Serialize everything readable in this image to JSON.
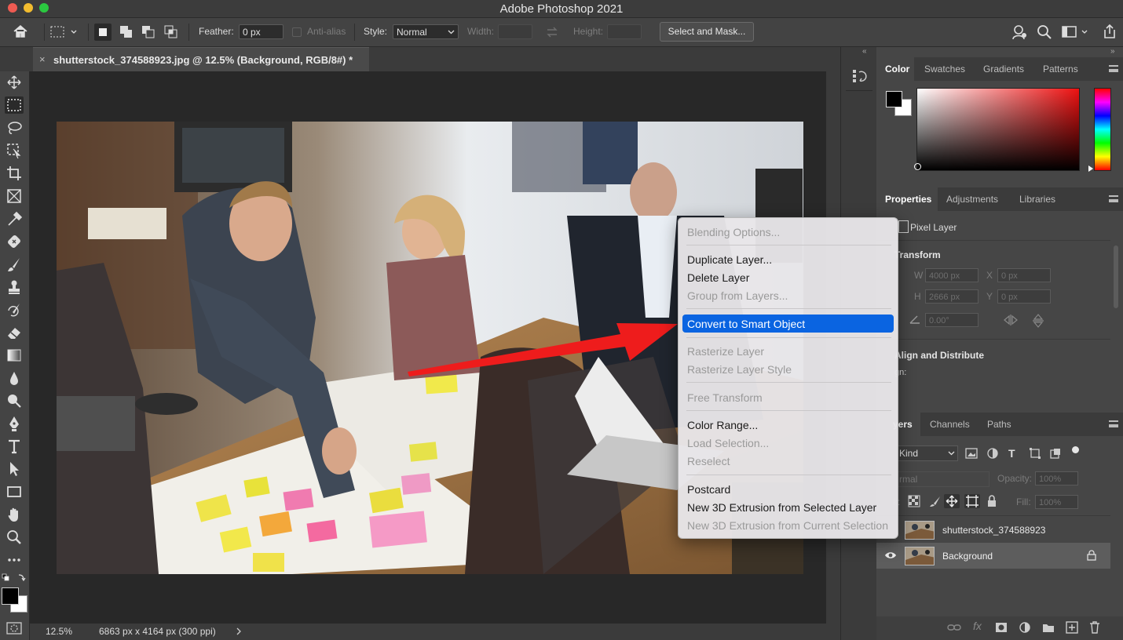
{
  "app": {
    "title": "Adobe Photoshop 2021"
  },
  "options_bar": {
    "feather_label": "Feather:",
    "feather_value": "0 px",
    "antialias_label": "Anti-alias",
    "style_label": "Style:",
    "style_value": "Normal",
    "width_label": "Width:",
    "height_label": "Height:",
    "select_mask_label": "Select and Mask..."
  },
  "document": {
    "tab_label": "shutterstock_374588923.jpg @ 12.5% (Background, RGB/8#) *"
  },
  "status": {
    "zoom": "12.5%",
    "info": "6863 px x 4164 px (300 ppi)"
  },
  "color_panel": {
    "tabs": [
      "Color",
      "Swatches",
      "Gradients",
      "Patterns"
    ]
  },
  "properties_panel": {
    "tabs": [
      "Properties",
      "Adjustments",
      "Libraries"
    ],
    "layer_type": "Pixel Layer",
    "transform_title": "Transform",
    "w_label": "W",
    "w_value": "4000 px",
    "h_label": "H",
    "h_value": "2666 px",
    "x_label": "X",
    "x_value": "0 px",
    "y_label": "Y",
    "y_value": "0 px",
    "angle_value": "0.00°",
    "align_title": "Align and Distribute",
    "align_sub": "gn:"
  },
  "layers_panel": {
    "tabs": [
      "yers",
      "Channels",
      "Paths"
    ],
    "filter_value": "Kind",
    "blend_value": "rmal",
    "opacity_label": "Opacity:",
    "opacity_value": "100%",
    "lock_label": "k:",
    "fill_label": "Fill:",
    "fill_value": "100%",
    "layers": [
      {
        "name": "shutterstock_374588923",
        "visible": false,
        "locked": false
      },
      {
        "name": "Background",
        "visible": true,
        "locked": true
      }
    ]
  },
  "context_menu": {
    "items": [
      {
        "label": "Blending Options...",
        "enabled": false
      },
      {
        "label": "Duplicate Layer...",
        "enabled": true
      },
      {
        "label": "Delete Layer",
        "enabled": true
      },
      {
        "label": "Group from Layers...",
        "enabled": false
      },
      {
        "label": "Convert to Smart Object",
        "enabled": true,
        "highlighted": true
      },
      {
        "label": "Rasterize Layer",
        "enabled": false
      },
      {
        "label": "Rasterize Layer Style",
        "enabled": false
      },
      {
        "label": "Free Transform",
        "enabled": false
      },
      {
        "label": "Color Range...",
        "enabled": true
      },
      {
        "label": "Load Selection...",
        "enabled": false
      },
      {
        "label": "Reselect",
        "enabled": false
      },
      {
        "label": "Postcard",
        "enabled": true
      },
      {
        "label": "New 3D Extrusion from Selected Layer",
        "enabled": true
      },
      {
        "label": "New 3D Extrusion from Current Selection",
        "enabled": false
      }
    ]
  },
  "colors": {
    "menu_highlight": "#0a64e1",
    "annotation_arrow": "#ee1c1c",
    "panel_bg": "#464646"
  },
  "tools": [
    "move-icon",
    "marquee-icon",
    "lasso-icon",
    "object-select-icon",
    "crop-icon",
    "frame-icon",
    "eyedropper-icon",
    "healing-brush-icon",
    "brush-icon",
    "clone-stamp-icon",
    "history-brush-icon",
    "eraser-icon",
    "gradient-icon",
    "blur-icon",
    "dodge-icon",
    "pen-icon",
    "type-icon",
    "path-select-icon",
    "rectangle-icon",
    "hand-icon",
    "zoom-icon",
    "more-tools-icon"
  ]
}
